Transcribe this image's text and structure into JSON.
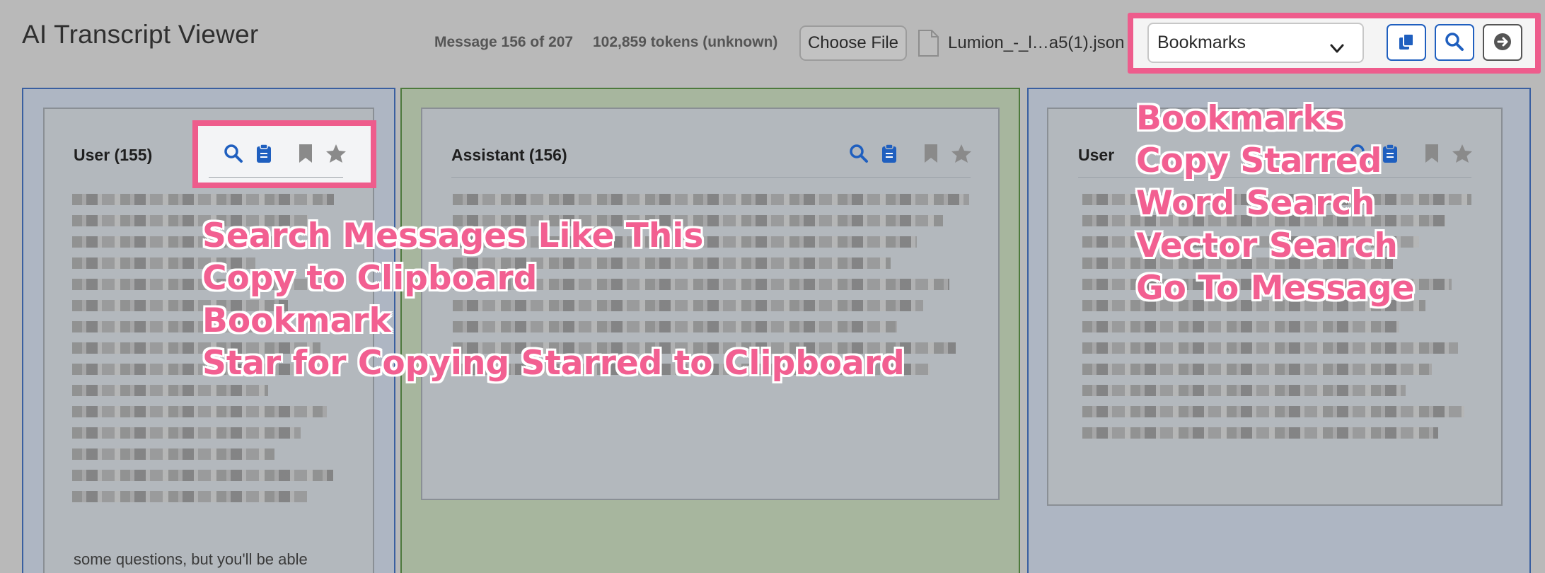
{
  "header": {
    "title": "AI Transcript Viewer",
    "message_counter": "Message 156 of 207",
    "token_count": "102,859 tokens (unknown)",
    "choose_file_label": "Choose File",
    "file_name": "Lumion_-_l…a5(1).json"
  },
  "toolbar": {
    "select_value": "Bookmarks",
    "buttons": [
      {
        "icon": "copy-starred-icon",
        "color": "#1f5fbf"
      },
      {
        "icon": "search-icon",
        "color": "#1f5fbf"
      },
      {
        "icon": "go-to-arrow-icon",
        "color": "#555555"
      }
    ]
  },
  "messages": [
    {
      "title": "User (155)",
      "visible_text": "some questions, but you'll be able"
    },
    {
      "title": "Assistant (156)"
    },
    {
      "title": "User (157)"
    }
  ],
  "annotations": {
    "left": [
      "Search Messages Like This",
      "Copy to Clipboard",
      "Bookmark",
      "Star for Copying Starred to Clipboard"
    ],
    "right": [
      "Bookmarks",
      "Copy Starred",
      "Word Search",
      "Vector Search",
      "Go To Message"
    ]
  },
  "colors": {
    "highlight": "#ee5c8c",
    "annotation_text": "#f25f91",
    "icon_blue": "#1f5fbf",
    "icon_grey": "#8a8a8a"
  }
}
